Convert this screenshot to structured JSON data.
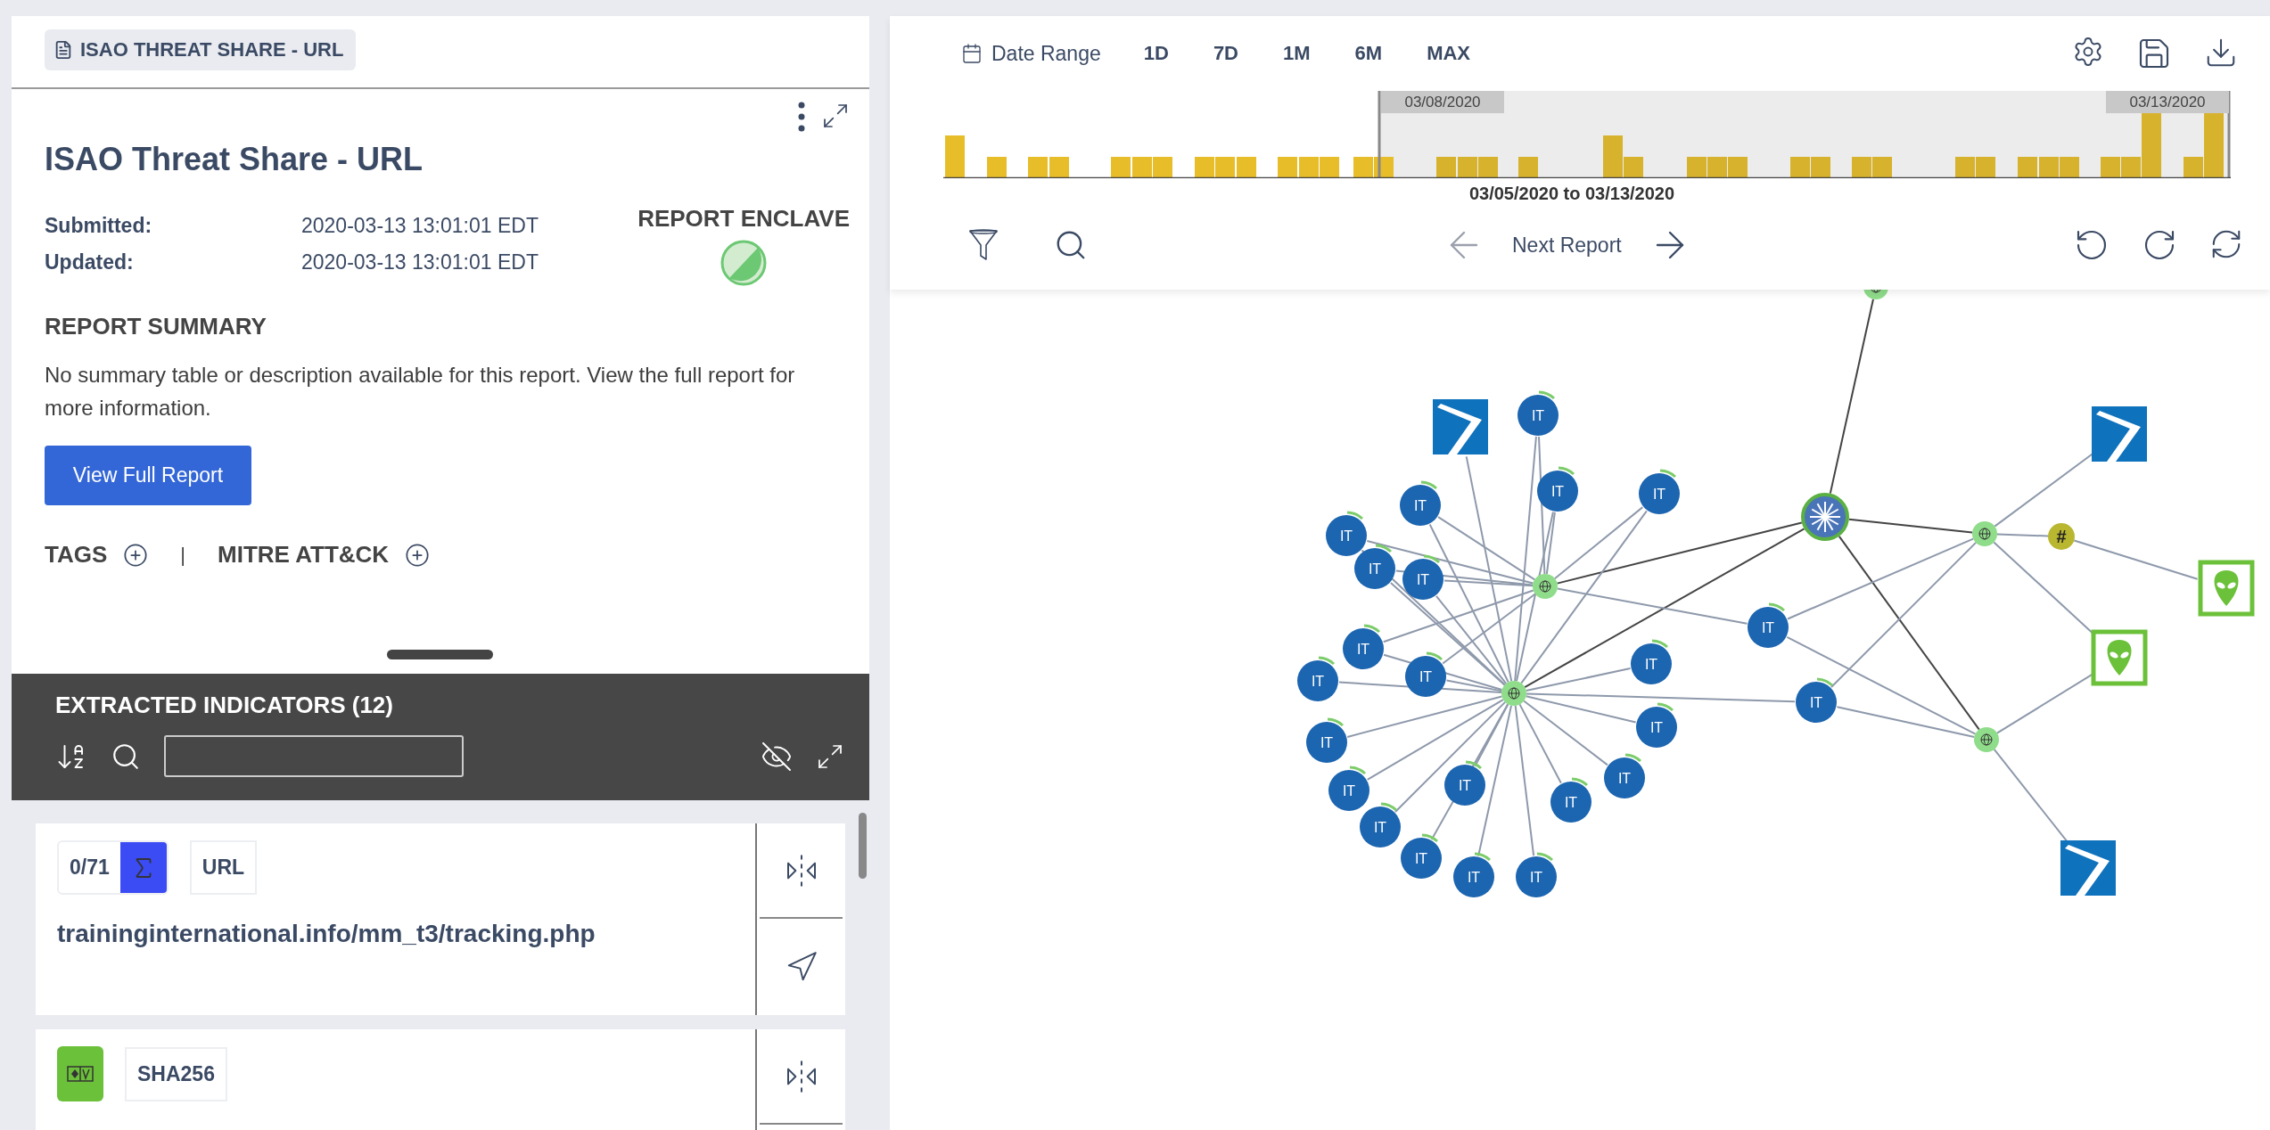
{
  "report_tab": {
    "label": "ISAO THREAT SHARE - URL"
  },
  "report": {
    "title": "ISAO Threat Share - URL",
    "fields": [
      {
        "label": "Submitted:",
        "value": "2020-03-13 13:01:01 EDT"
      },
      {
        "label": "Updated:",
        "value": "2020-03-13 13:01:01 EDT"
      }
    ],
    "enclave_label": "REPORT ENCLAVE",
    "summary_heading": "REPORT SUMMARY",
    "summary_text": "No summary table or description available for this report. View the full report for more information.",
    "view_button": "View Full Report",
    "tags_label": "TAGS",
    "separator": "|",
    "mitre_label": "MITRE ATT&CK"
  },
  "indicators": {
    "title": "EXTRACTED INDICATORS (12)",
    "items": [
      {
        "kind": "url",
        "score": "0/71",
        "type": "URL",
        "value": "traininginternational.info/mm_t3/tracking.php"
      },
      {
        "kind": "hash",
        "type": "SHA256"
      }
    ]
  },
  "timeline": {
    "date_range_label": "Date Range",
    "ranges": [
      {
        "label": "1D"
      },
      {
        "label": "7D"
      },
      {
        "label": "1M"
      },
      {
        "label": "6M"
      },
      {
        "label": "MAX"
      }
    ],
    "start_label": "03/08/2020",
    "end_label": "03/13/2020",
    "range_text": "03/05/2020 to 03/13/2020"
  },
  "navigation": {
    "next_label": "Next Report"
  },
  "graph": {
    "nodes": [
      {
        "kind": "globe"
      },
      {
        "kind": "globe"
      },
      {
        "kind": "globe"
      },
      {
        "kind": "globe"
      },
      {
        "kind": "globe"
      },
      {
        "kind": "star"
      },
      {
        "kind": "hash",
        "label": "#"
      },
      {
        "kind": "tile"
      },
      {
        "kind": "tile"
      },
      {
        "kind": "tile"
      },
      {
        "kind": "alien"
      },
      {
        "kind": "alien"
      },
      {
        "kind": "indicator",
        "label": "IT"
      },
      {
        "kind": "indicator",
        "label": "IT"
      },
      {
        "kind": "indicator",
        "label": "IT"
      },
      {
        "kind": "indicator",
        "label": "IT"
      },
      {
        "kind": "indicator",
        "label": "IT"
      },
      {
        "kind": "indicator",
        "label": "IT"
      },
      {
        "kind": "indicator",
        "label": "IT"
      },
      {
        "kind": "indicator",
        "label": "IT"
      },
      {
        "kind": "indicator",
        "label": "IT"
      },
      {
        "kind": "indicator",
        "label": "IT"
      },
      {
        "kind": "indicator",
        "label": "IT"
      },
      {
        "kind": "indicator",
        "label": "IT"
      },
      {
        "kind": "indicator",
        "label": "IT"
      },
      {
        "kind": "indicator",
        "label": "IT"
      },
      {
        "kind": "indicator",
        "label": "IT"
      },
      {
        "kind": "indicator",
        "label": "IT"
      },
      {
        "kind": "indicator",
        "label": "IT"
      },
      {
        "kind": "indicator",
        "label": "IT"
      },
      {
        "kind": "indicator",
        "label": "IT"
      },
      {
        "kind": "indicator",
        "label": "IT"
      },
      {
        "kind": "indicator",
        "label": "IT"
      },
      {
        "kind": "indicator",
        "label": "IT"
      },
      {
        "kind": "indicator",
        "label": "IT"
      }
    ]
  }
}
